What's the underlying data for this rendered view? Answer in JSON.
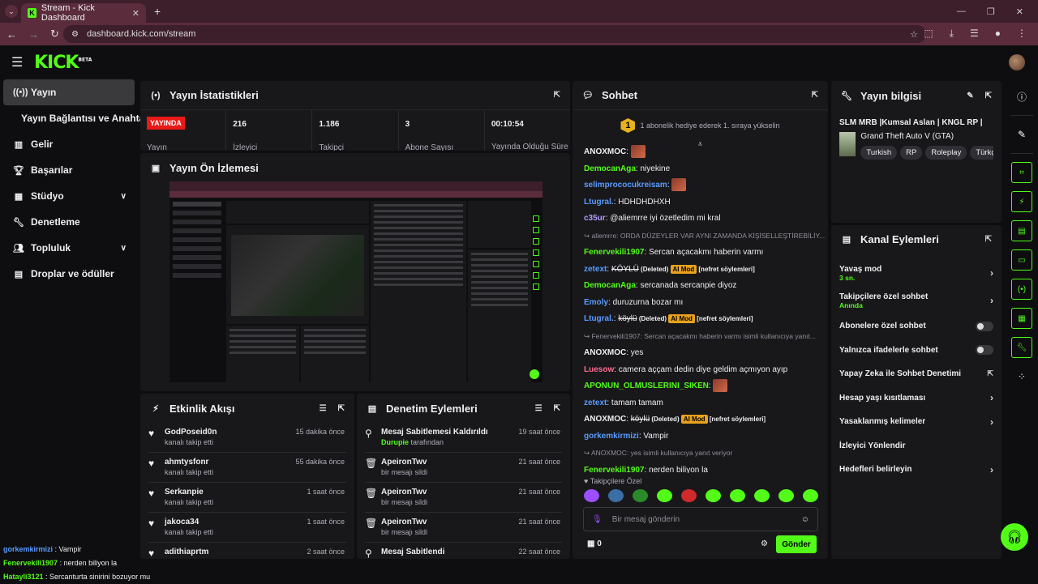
{
  "browser": {
    "tab_title": "Stream - Kick Dashboard",
    "url": "dashboard.kick.com/stream"
  },
  "brand": {
    "logo": "KICK",
    "beta": "BETA"
  },
  "sidebar": {
    "items": [
      {
        "label": "Yayın",
        "icon": "broadcast-icon"
      },
      {
        "label": "Yayın Bağlantısı ve Anahtarı"
      },
      {
        "label": "Gelir",
        "icon": "chart-icon"
      },
      {
        "label": "Başarılar",
        "icon": "trophy-icon"
      },
      {
        "label": "Stüdyo",
        "icon": "studio-icon"
      },
      {
        "label": "Denetleme",
        "icon": "wrench-icon"
      },
      {
        "label": "Topluluk",
        "icon": "community-icon"
      },
      {
        "label": "Droplar ve ödüller",
        "icon": "gift-icon"
      }
    ]
  },
  "stats_panel": {
    "title": "Yayın İstatistikleri",
    "live_badge": "YAYINDA",
    "stats": [
      {
        "value": "",
        "label": "Yayın"
      },
      {
        "value": "216",
        "label": "İzleyici"
      },
      {
        "value": "1.186",
        "label": "Takipçi"
      },
      {
        "value": "3",
        "label": "Abone Sayısı"
      },
      {
        "value": "00:10:54",
        "label": "Yayında Olduğu Süre"
      }
    ]
  },
  "preview_panel": {
    "title": "Yayın Ön İzlemesi"
  },
  "activity_panel": {
    "title": "Etkinlik Akışı",
    "items": [
      {
        "name": "GodPoseid0n",
        "desc": "kanalı takip etti",
        "time": "15 dakika önce"
      },
      {
        "name": "ahmtysfonr",
        "desc": "kanalı takip etti",
        "time": "55 dakika önce"
      },
      {
        "name": "Serkanpie",
        "desc": "kanalı takip etti",
        "time": "1 saat önce"
      },
      {
        "name": "jakoca34",
        "desc": "kanalı takip etti",
        "time": "1 saat önce"
      },
      {
        "name": "adithiaprtm",
        "desc": "",
        "time": "2 saat önce"
      }
    ]
  },
  "mod_panel": {
    "title": "Denetim Eylemleri",
    "items": [
      {
        "name": "Mesaj Sabitlemesi Kaldırıldı",
        "by": "Durupie",
        "suffix": "tarafından",
        "time": "19 saat önce"
      },
      {
        "name": "ApeironTwv",
        "by": "",
        "suffix": "bir mesajı sildi",
        "time": "21 saat önce"
      },
      {
        "name": "ApeironTwv",
        "by": "",
        "suffix": "bir mesajı sildi",
        "time": "21 saat önce"
      },
      {
        "name": "ApeironTwv",
        "by": "",
        "suffix": "bir mesajı sildi",
        "time": "21 saat önce"
      },
      {
        "name": "Mesaj Sabitlendi",
        "by": "",
        "suffix": "",
        "time": "22 saat önce"
      }
    ]
  },
  "chat_panel": {
    "title": "Sohbet",
    "gift_rank": "1",
    "gift_text": "1 abonelik hediye ederek 1. sıraya yükselin",
    "messages": [
      {
        "user": "ANOXMOC",
        "color": "#efeff1",
        "text": "",
        "emote": true
      },
      {
        "user": "DemocanAga",
        "color": "#53fc18",
        "text": "niyekine"
      },
      {
        "user": "selimprococukreisam",
        "color": "#5a9bff",
        "text": "",
        "emote": true
      },
      {
        "user": "Ltugral.",
        "color": "#5a9bff",
        "text": "HDHDHDHXH"
      },
      {
        "user": "c35ur",
        "color": "#b49bff",
        "text": "@aliemrre iyi özetledim mi kral"
      },
      {
        "reply": "aliemrre: ORDA DÜZEYLER VAR AYNI ZAMANDA KİŞİSELLEŞTİREBİLİY..."
      },
      {
        "user": "Fenervekili1907",
        "color": "#53fc18",
        "text": "Sercan açacakmı haberin varmı"
      },
      {
        "user": "zetext",
        "color": "#5a9bff",
        "struck": "KÖYLÜ",
        "deleted": "(Deleted)",
        "ai": "AI Mod",
        "tag": "[nefret söylemleri]"
      },
      {
        "user": "DemocanAga",
        "color": "#53fc18",
        "text": "sercanada sercanpie diyoz"
      },
      {
        "user": "Emoly",
        "color": "#5a9bff",
        "text": "duruzurna bozar mı"
      },
      {
        "user": "Ltugral.",
        "color": "#5a9bff",
        "struck": "köylü",
        "deleted": "(Deleted)",
        "ai": "AI Mod",
        "tag": "[nefret söylemleri]"
      },
      {
        "reply": "Fenervekili1907: Sercan açacakmı haberin varmı isimli kullanıcıya yanıt..."
      },
      {
        "user": "ANOXMOC",
        "color": "#efeff1",
        "text": "yes"
      },
      {
        "user": "Luesow",
        "color": "#ff6b8b",
        "text": "camera aççam dedin diye geldim açmıyon ayıp"
      },
      {
        "user": "APONUN_OLMUSLERINI_SIKEN",
        "color": "#53fc18",
        "text": "",
        "emote": true
      },
      {
        "user": "zetext",
        "color": "#5a9bff",
        "text": "tamam tamam"
      },
      {
        "user": "ANOXMOC",
        "color": "#efeff1",
        "struck": "köylü",
        "deleted": "(Deleted)",
        "ai": "AI Mod",
        "tag": "[nefret söylemleri]"
      },
      {
        "user": "gorkemkirmizi",
        "color": "#5a9bff",
        "text": "Vampir"
      },
      {
        "reply": "ANOXMOC: yes isimli kullanıcıya yanıt veriyor"
      },
      {
        "user": "Fenervekili1907",
        "color": "#53fc18",
        "text": "nerden biliyon la"
      },
      {
        "user": "Hatayli3121",
        "color": "#53fc18",
        "text": "Sercanturta sinirini bozuyor mu"
      }
    ],
    "followers_only": "Takipçilere Özel",
    "input_placeholder": "Bir mesaj gönderin",
    "points": "0",
    "send_label": "Gönder"
  },
  "stream_info": {
    "title": "Yayın bilgisi",
    "stream_title": "SLM MRB |Kumsal Aslan | KNGL RP |",
    "category": "Grand Theft Auto V (GTA)",
    "tags": [
      "Turkish",
      "RP",
      "Roleplay",
      "Türkç"
    ]
  },
  "channel_actions": {
    "title": "Kanal Eylemleri",
    "rows": [
      {
        "label": "Yavaş mod",
        "sub": "3 sn.",
        "control": "arrow"
      },
      {
        "label": "Takipçilere özel sohbet",
        "sub": "Anında",
        "control": "arrow"
      },
      {
        "label": "Abonelere özel sohbet",
        "sub": "",
        "control": "toggle"
      },
      {
        "label": "Yalnızca ifadelerle sohbet",
        "sub": "",
        "control": "toggle"
      },
      {
        "label": "Yapay Zeka ile Sohbet Denetimi",
        "sub": "",
        "control": "external"
      },
      {
        "label": "Hesap yaşı kısıtlaması",
        "sub": "",
        "control": "arrow"
      },
      {
        "label": "Yasaklanmış kelimeler",
        "sub": "",
        "control": "arrow"
      },
      {
        "label": "İzleyici Yönlendir",
        "sub": "",
        "control": "none"
      },
      {
        "label": "Hedefleri belirleyin",
        "sub": "",
        "control": "arrow"
      }
    ]
  },
  "overlay_chat": [
    {
      "user": "gorkemkirmizi",
      "color": "#5a9bff",
      "text": ": Vampir"
    },
    {
      "user": "Fenervekili1907",
      "color": "#53fc18",
      "text": ": nerden biliyon la"
    },
    {
      "user": "Hatayli3121",
      "color": "#53fc18",
      "text": ": Sercanturta sinirini bozuyor mu"
    }
  ],
  "colors": {
    "accent": "#53fc18",
    "live": "#e91916",
    "panel": "#18181b",
    "ai_badge": "#e8a21c"
  }
}
